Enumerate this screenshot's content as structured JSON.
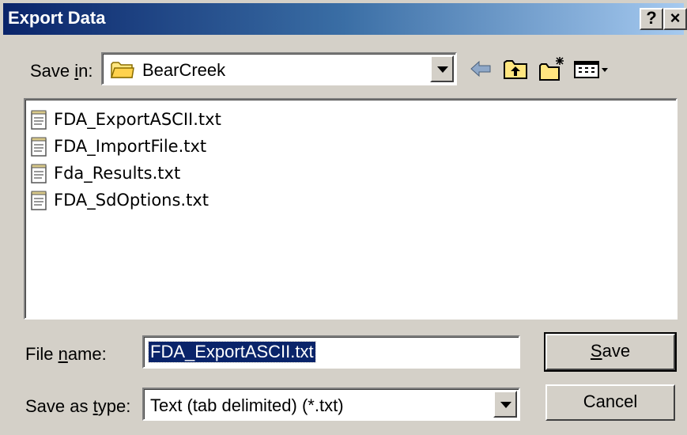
{
  "window": {
    "title": "Export Data",
    "help_label": "?",
    "close_label": "×"
  },
  "save_in": {
    "label_pre": "Save ",
    "label_mnemonic": "i",
    "label_post": "n:",
    "value": "BearCreek"
  },
  "toolbar": {
    "icons": [
      "back-icon",
      "up-folder-icon",
      "new-folder-icon",
      "views-menu-icon"
    ]
  },
  "files": [
    {
      "name": "FDA_ExportASCII.txt",
      "icon": "text-file-icon"
    },
    {
      "name": "FDA_ImportFile.txt",
      "icon": "text-file-icon"
    },
    {
      "name": "Fda_Results.txt",
      "icon": "text-file-icon"
    },
    {
      "name": "FDA_SdOptions.txt",
      "icon": "text-file-icon"
    }
  ],
  "file_name": {
    "label_pre": "File ",
    "label_mnemonic": "n",
    "label_post": "ame:",
    "value": "FDA_ExportASCII.txt"
  },
  "save_as_type": {
    "label_pre": "Save as ",
    "label_mnemonic": "t",
    "label_post": "ype:",
    "value": "Text (tab delimited) (*.txt)"
  },
  "buttons": {
    "save_mnemonic": "S",
    "save_rest": "ave",
    "cancel": "Cancel"
  },
  "colors": {
    "title_start": "#0a246a",
    "title_end": "#a6caf0",
    "face": "#d4d0c8",
    "selection": "#0a246a"
  }
}
